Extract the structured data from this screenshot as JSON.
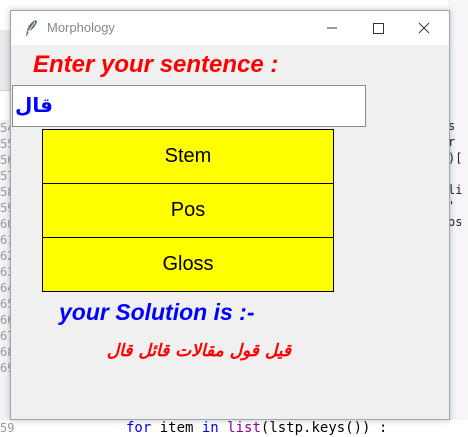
{
  "window": {
    "title": "Morphology"
  },
  "form": {
    "heading": "Enter your sentence :",
    "input_value": "قال"
  },
  "buttons": {
    "stem": "Stem",
    "pos": "Pos",
    "gloss": "Gloss"
  },
  "solution": {
    "label": "your Solution is :-",
    "text": "قيل قول مقالات قائل قال"
  },
  "background_editor": {
    "line_numbers": [
      "54",
      "55",
      "56",
      "57",
      "58",
      "59",
      "60",
      "61",
      "62",
      "63",
      "64",
      "65",
      "66",
      "67",
      "68",
      "69"
    ],
    "right_code": [
      "s",
      "r",
      ")[",
      "",
      "li",
      "'",
      "os"
    ],
    "bottom_line_number": "59",
    "bottom_code": {
      "kw_for": "for",
      "var_item": " item ",
      "kw_in": "in",
      "fn_list": " list",
      "rest": "(lstp.keys()) :"
    }
  },
  "colors": {
    "heading": "#ff0000",
    "input_text": "#0000ff",
    "button_bg": "#ffff00",
    "solution_label": "#0000ff",
    "solution_text": "#ff0000",
    "window_bg": "#f0f0f0"
  },
  "icons": {
    "app": "feather-icon",
    "minimize": "minimize-icon",
    "maximize": "maximize-icon",
    "close": "close-icon"
  }
}
